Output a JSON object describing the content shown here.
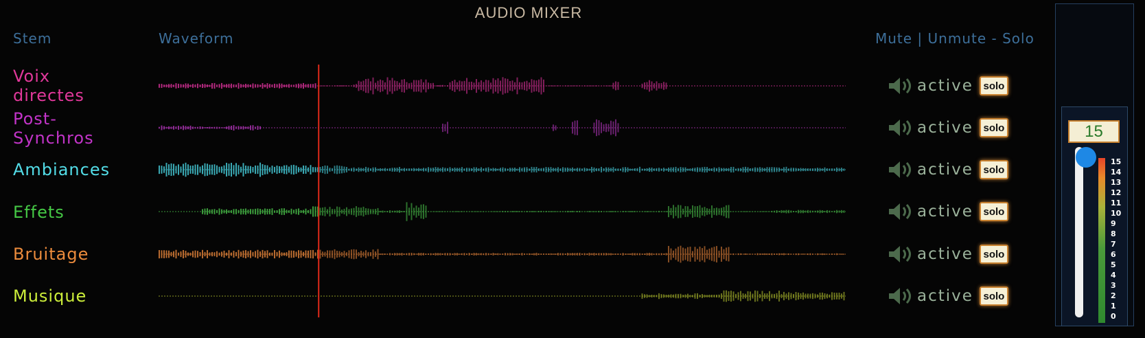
{
  "app": {
    "title": "AUDIO MIXER"
  },
  "headers": {
    "stem": "Stem",
    "waveform": "Waveform",
    "controls": "Mute | Unmute - Solo"
  },
  "stems": [
    {
      "name_lines": [
        "Voix",
        "directes"
      ],
      "color": "#e0389a",
      "wave_color": "#b0287c",
      "status": "active",
      "solo_label": "solo",
      "speaker_icon": "speaker-icon"
    },
    {
      "name_lines": [
        "Post-",
        "Synchros"
      ],
      "color": "#c234c8",
      "wave_color": "#8e2b94",
      "status": "active",
      "solo_label": "solo",
      "speaker_icon": "speaker-icon"
    },
    {
      "name_lines": [
        "Ambiances"
      ],
      "color": "#53dde8",
      "wave_color": "#3aa9b4",
      "status": "active",
      "solo_label": "solo",
      "speaker_icon": "speaker-icon"
    },
    {
      "name_lines": [
        "Effets"
      ],
      "color": "#45c845",
      "wave_color": "#3b9a3b",
      "status": "active",
      "solo_label": "solo",
      "speaker_icon": "speaker-icon"
    },
    {
      "name_lines": [
        "Bruitage"
      ],
      "color": "#eb8b3c",
      "wave_color": "#b86a2f",
      "status": "active",
      "solo_label": "solo",
      "speaker_icon": "speaker-icon"
    },
    {
      "name_lines": [
        "Musique"
      ],
      "color": "#ccee3a",
      "wave_color": "#8f9a25",
      "status": "active",
      "solo_label": "solo",
      "speaker_icon": "speaker-icon"
    }
  ],
  "playhead": {
    "position_fraction": 0.233,
    "color": "#e02a1a"
  },
  "master": {
    "value": "15",
    "level_fraction": 1.0,
    "scale": [
      "15",
      "14",
      "13",
      "12",
      "11",
      "10",
      "9",
      "8",
      "7",
      "6",
      "5",
      "4",
      "3",
      "2",
      "1",
      "0"
    ]
  }
}
